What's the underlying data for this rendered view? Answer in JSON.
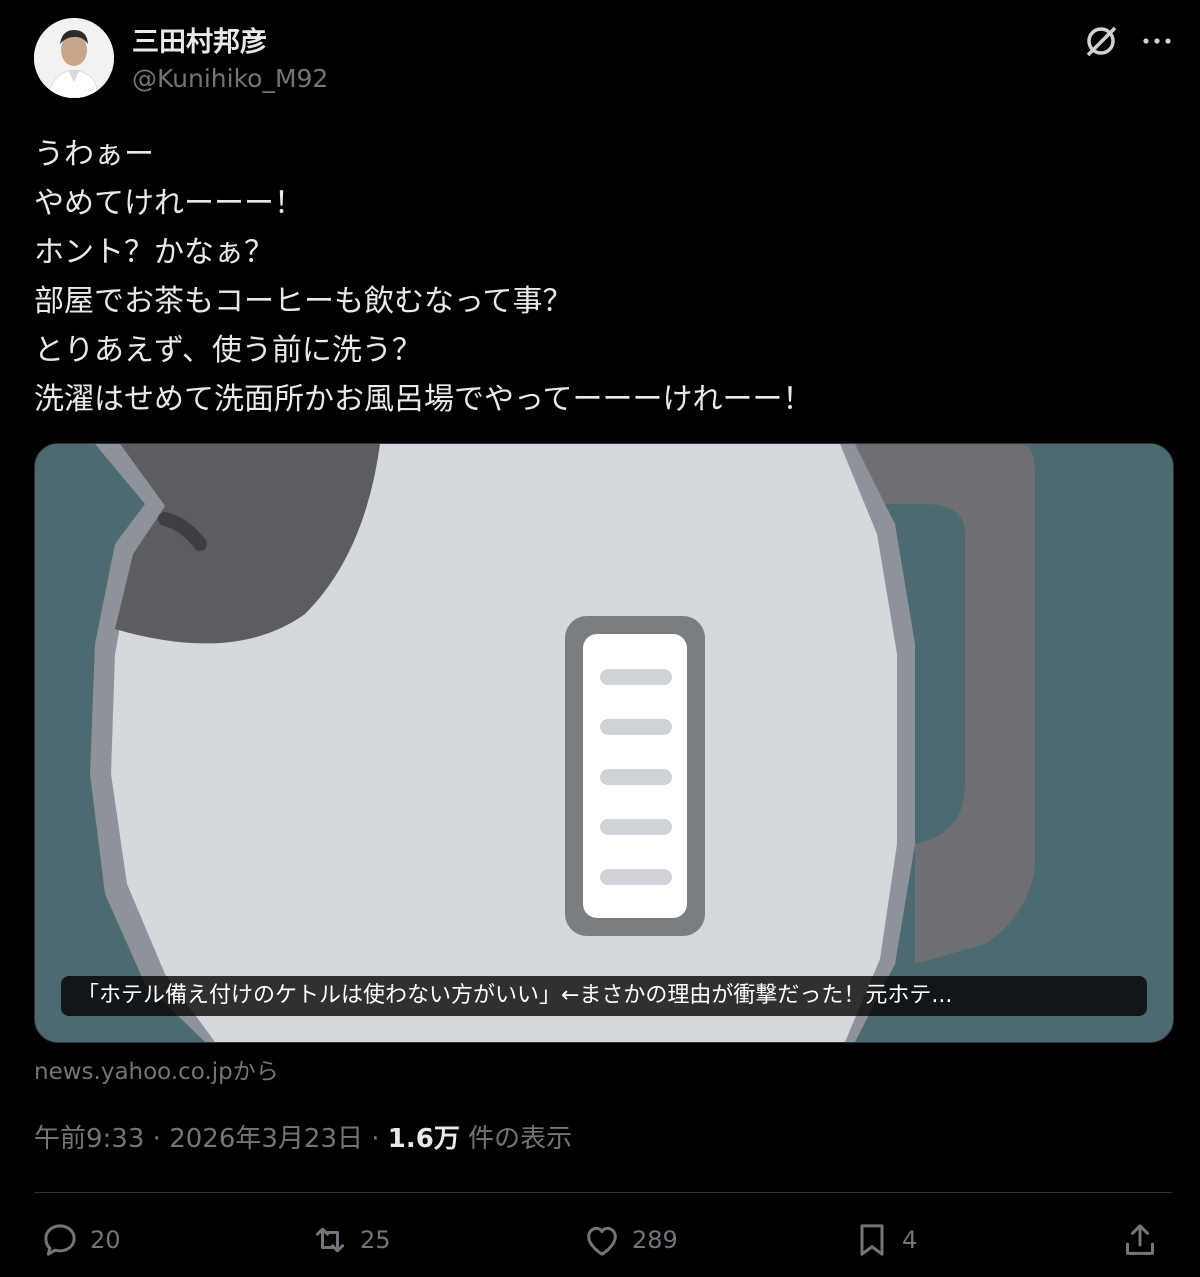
{
  "user": {
    "display_name": "三田村邦彦",
    "handle": "@Kunihiko_M92"
  },
  "tweet": {
    "lines": [
      "うわぁー",
      "やめてけれーーー！",
      "ホント？かなぁ？",
      "部屋でお茶もコーヒーも飲むなって事？",
      "とりあえず、使う前に洗う？",
      "洗濯はせめて洗面所かお風呂場でやってーーーけれーー！"
    ]
  },
  "card": {
    "title": "「ホテル備え付けのケトルは使わない方がいい」←まさかの理由が衝撃だった！元ホテ...",
    "source": "news.yahoo.co.jpから"
  },
  "meta": {
    "time": "午前9:33",
    "separator": "·",
    "date": "2026年3月23日",
    "views_count": "1.6万",
    "views_label": "件の表示"
  },
  "actions": {
    "replies": "20",
    "reposts": "25",
    "likes": "289",
    "bookmarks": "4"
  },
  "icons": [
    "grok-icon",
    "more-icon",
    "reply-icon",
    "repost-icon",
    "like-icon",
    "bookmark-icon",
    "share-icon"
  ],
  "colors": {
    "background": "#000000",
    "text": "#e7e9ea",
    "muted": "#71767b",
    "card_bg": "#4d6a70"
  }
}
